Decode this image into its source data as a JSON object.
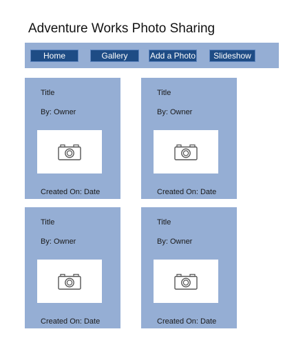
{
  "header": {
    "title": "Adventure Works Photo Sharing"
  },
  "nav": {
    "items": [
      {
        "label": "Home"
      },
      {
        "label": "Gallery"
      },
      {
        "label": "Add a Photo"
      },
      {
        "label": "Slideshow"
      }
    ]
  },
  "colors": {
    "nav_background": "#95aed4",
    "nav_button": "#1e4c85",
    "card_background": "#95aed4",
    "photo_background": "#ffffff"
  },
  "photos": [
    {
      "title": "Title",
      "owner": "By: Owner",
      "created": "Created On: Date",
      "icon": "camera-icon"
    },
    {
      "title": "Title",
      "owner": "By: Owner",
      "created": "Created On: Date",
      "icon": "camera-icon"
    },
    {
      "title": "Title",
      "owner": "By: Owner",
      "created": "Created On: Date",
      "icon": "camera-icon"
    },
    {
      "title": "Title",
      "owner": "By: Owner",
      "created": "Created On: Date",
      "icon": "camera-icon"
    }
  ]
}
